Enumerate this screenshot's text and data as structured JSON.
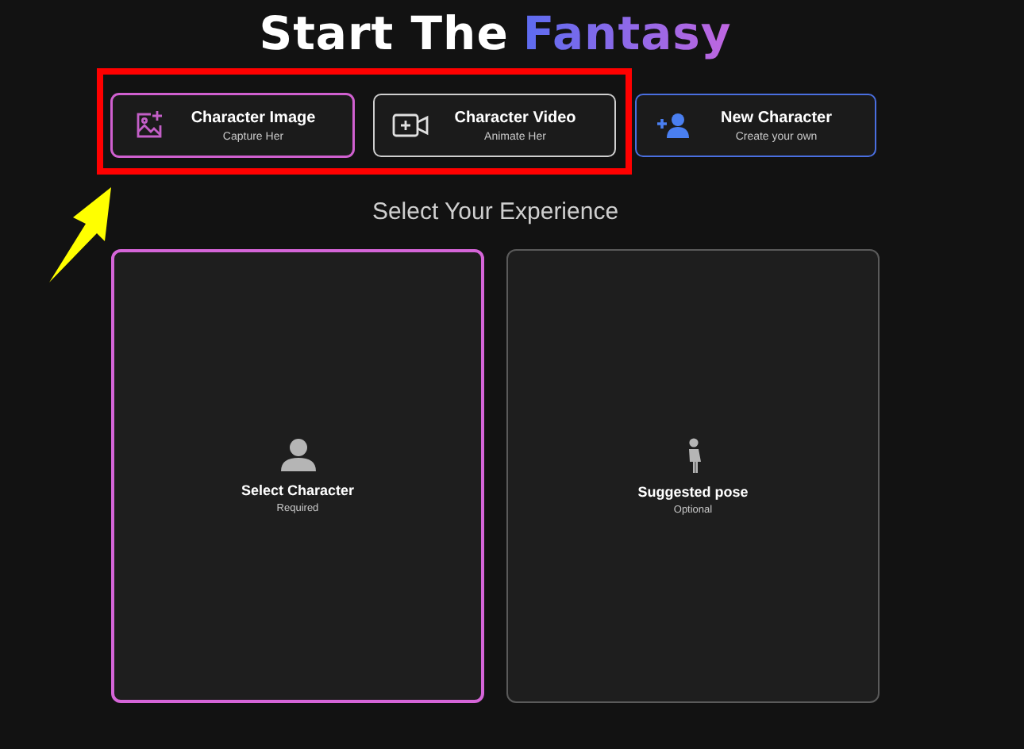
{
  "title": {
    "lead": "Start The",
    "highlight": "Fantasy"
  },
  "modes": [
    {
      "kind": "image",
      "label": "Character Image",
      "sublabel": "Capture Her",
      "selected": true
    },
    {
      "kind": "video",
      "label": "Character Video",
      "sublabel": "Animate Her",
      "selected": false
    },
    {
      "kind": "new",
      "label": "New Character",
      "sublabel": "Create your own",
      "selected": false
    }
  ],
  "section_heading": "Select Your Experience",
  "slots": [
    {
      "kind": "character",
      "label": "Select Character",
      "note": "Required",
      "selected": true
    },
    {
      "kind": "pose",
      "label": "Suggested pose",
      "note": "Optional",
      "selected": false
    }
  ]
}
